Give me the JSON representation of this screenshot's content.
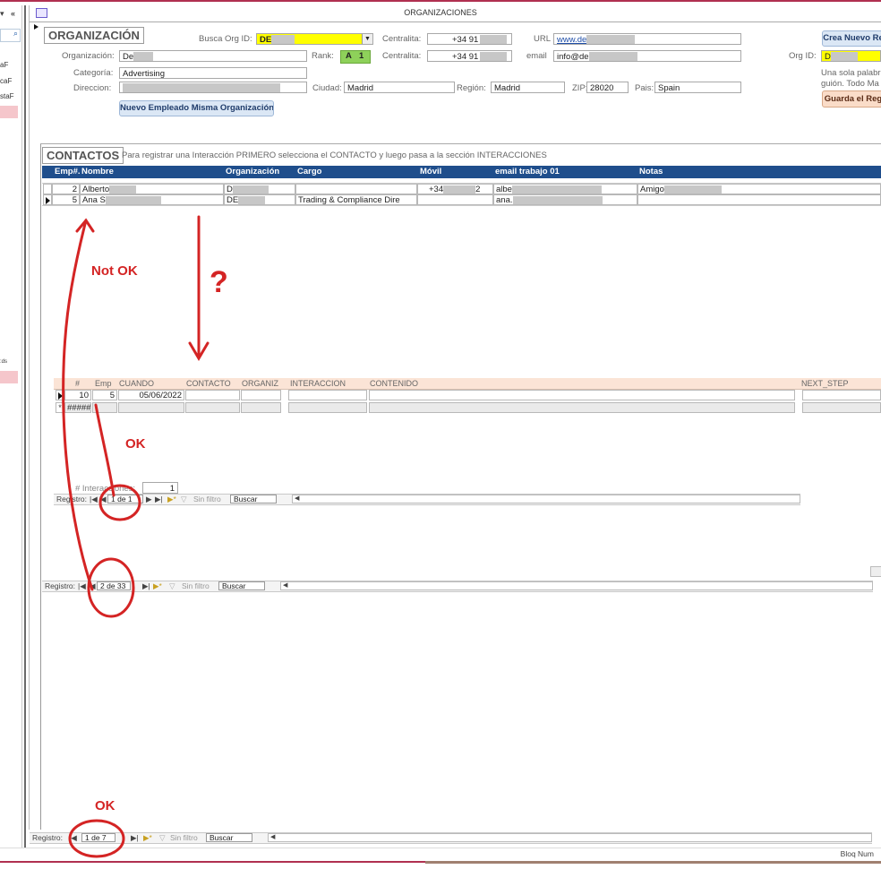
{
  "window": {
    "title": "ORGANIZACIONES"
  },
  "nav_pane": {
    "items": [
      "aF",
      "caF",
      "staF",
      ":ds"
    ]
  },
  "org": {
    "section_title": "ORGANIZACIÓN",
    "busca_label": "Busca Org ID:",
    "busca_value": "DE",
    "centralita_label": "Centralita:",
    "centralita1_value": "+34 91",
    "centralita2_value": "+34 91",
    "url_label": "URL",
    "url_value": "www.de",
    "crea_button": "Crea Nuevo Re",
    "organizacion_label": "Organización:",
    "organizacion_value": "De",
    "rank_label": "Rank:",
    "rank_letter": "A",
    "rank_number": "1",
    "email_label": "email",
    "email_value": "info@de",
    "orgid_label": "Org ID:",
    "orgid_value": "D",
    "categoria_label": "Categoría:",
    "categoria_value": "Advertising",
    "hint_line1": "Una sola palabr",
    "hint_line2": "guión. Todo Ma",
    "direccion_label": "Direccion:",
    "ciudad_label": "Ciudad:",
    "ciudad_value": "Madrid",
    "region_label": "Región:",
    "region_value": "Madrid",
    "zip_label": "ZIP:",
    "zip_value": "28020",
    "pais_label": "Pais:",
    "pais_value": "Spain",
    "guarda_button": "Guarda el Reg",
    "nuevo_empleado_button": "Nuevo Empleado Misma Organización"
  },
  "contactos": {
    "section_title": "CONTACTOS",
    "instruction": "Para registrar una Interacción PRIMERO selecciona el CONTACTO y luego pasa a la sección INTERACCIONES",
    "columns": [
      "Emp#.",
      "Nombre",
      "Organización",
      "Cargo",
      "Móvil",
      "email trabajo 01",
      "Notas"
    ],
    "rows": [
      {
        "emp": "2",
        "nombre": "Alberto",
        "org": "D",
        "cargo": "",
        "movil": "+34",
        "movil_end": "2",
        "email": "albe",
        "notas": "Amigo"
      },
      {
        "emp": "5",
        "nombre": "Ana S",
        "org": "DE",
        "cargo": "Trading & Compliance Dire",
        "movil": "",
        "movil_end": "",
        "email": "ana.",
        "notas": ""
      }
    ]
  },
  "interacciones": {
    "columns": [
      "#",
      "Emp",
      "CUANDO",
      "CONTACTO",
      "ORGANIZ",
      "INTERACCION",
      "CONTENIDO",
      "NEXT_STEP"
    ],
    "row": {
      "num": "10",
      "emp": "5",
      "cuando": "05/06/2022"
    },
    "new_row_marker": "*",
    "new_row_value": "#####",
    "count_label": "# Interacciones:",
    "count_value": "1"
  },
  "nav_bars": {
    "registro_label": "Registro:",
    "sin_filtro": "Sin filtro",
    "buscar": "Buscar",
    "interacciones_pos": "1 de 1",
    "contactos_pos": "2 de 33",
    "main_pos": "1 de 7"
  },
  "annotations": {
    "not_ok": "Not OK",
    "question": "?",
    "ok1": "OK",
    "ok2": "OK",
    "color": "#d42424"
  },
  "status_bar": {
    "text": "Bloq Num"
  },
  "colors": {
    "grid_header": "#1f4e8c",
    "subform_header": "#fbe4d6",
    "highlight_yellow": "#ffff00",
    "rank_green": "#8ed15a",
    "accent_red": "#b03050"
  }
}
